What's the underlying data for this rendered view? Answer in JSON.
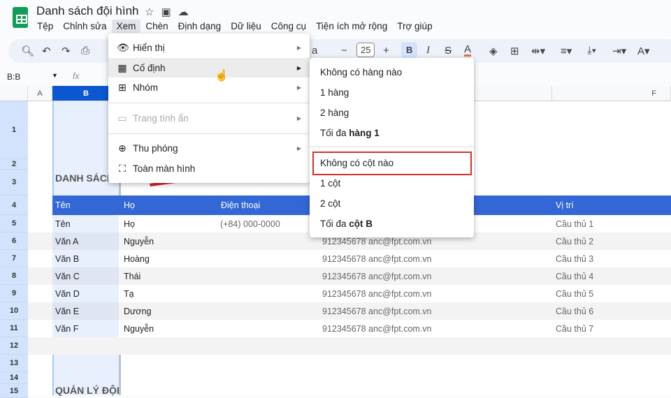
{
  "app": {
    "title": "Danh sách đội hình",
    "title_icons": [
      "star-icon",
      "move-folder-icon",
      "cloud-icon"
    ]
  },
  "menubar": [
    "Tệp",
    "Chỉnh sửa",
    "Xem",
    "Chèn",
    "Định dạng",
    "Dữ liệu",
    "Công cụ",
    "Tiện ích mở rộng",
    "Trợ giúp"
  ],
  "toolbar": {
    "font_size": "25",
    "font_fragment": "a"
  },
  "formula_bar": {
    "name_box": "B:B",
    "fx": "fx"
  },
  "columns": [
    "A",
    "B",
    "F"
  ],
  "rows": [
    "1",
    "2",
    "3",
    "4",
    "5",
    "6",
    "7",
    "8",
    "9",
    "10",
    "11",
    "12",
    "13",
    "14",
    "15"
  ],
  "sheet": {
    "title_cell": "DANH SÁCH",
    "footer_cell": "QUẢN LÝ ĐỘI",
    "headers": [
      "Tên",
      "Họ",
      "Điện thoại",
      "Vị trí"
    ],
    "data": [
      [
        "Tên",
        "Họ",
        "(+84) 000-0000",
        "",
        "Cầu thủ 1"
      ],
      [
        "Văn A",
        "Nguyễn",
        "912345678",
        "anc@fpt.com.vn",
        "Cầu thủ 2"
      ],
      [
        "Văn B",
        "Hoàng",
        "912345678",
        "anc@fpt.com.vn",
        "Cầu thủ 3"
      ],
      [
        "Văn C",
        "Thái",
        "912345678",
        "anc@fpt.com.vn",
        "Cầu thủ 4"
      ],
      [
        "Văn D",
        "Tạ",
        "912345678",
        "anc@fpt.com.vn",
        "Cầu thủ 5"
      ],
      [
        "Văn E",
        "Dương",
        "912345678",
        "anc@fpt.com.vn",
        "Cầu thủ 6"
      ],
      [
        "Văn F",
        "Nguyễn",
        "912345678",
        "anc@fpt.com.vn",
        "Cầu thủ 7"
      ]
    ],
    "header_color": "#3367d6"
  },
  "view_menu": {
    "items": [
      {
        "label": "Hiển thị",
        "icon": "eye-icon"
      },
      {
        "label": "Cố định",
        "icon": "freeze-icon"
      },
      {
        "label": "Nhóm",
        "icon": "group-plus-icon"
      },
      {
        "label": "Trang tính ẩn",
        "icon": "hidden-sheet-icon",
        "disabled": true
      },
      {
        "label": "Thu phóng",
        "icon": "zoom-icon"
      },
      {
        "label": "Toàn màn hình",
        "icon": "fullscreen-icon"
      }
    ]
  },
  "freeze_submenu": {
    "none_rows": "Không có hàng nào",
    "one_row": "1 hàng",
    "two_rows": "2 hàng",
    "upto_row_prefix": "Tối đa ",
    "upto_row_bold": "hàng 1",
    "none_cols": "Không có cột nào",
    "one_col": "1 cột",
    "two_cols": "2 cột",
    "upto_col_prefix": "Tối đa ",
    "upto_col_bold": "cột B",
    "highlight_color": "#d93025"
  }
}
